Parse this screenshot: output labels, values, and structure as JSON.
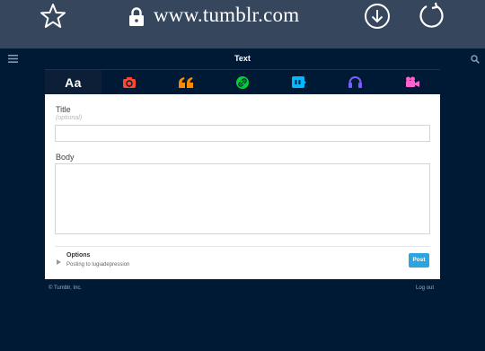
{
  "browser": {
    "url": "www.tumblr.com"
  },
  "header": {
    "title": "Text"
  },
  "tabs": [
    {
      "name": "text",
      "label": "Aa",
      "icon": "text-icon",
      "color": "#ffffff",
      "active": true
    },
    {
      "name": "photo",
      "icon": "camera-icon",
      "color": "#ff492f"
    },
    {
      "name": "quote",
      "icon": "quote-icon",
      "color": "#ff8a00"
    },
    {
      "name": "link",
      "icon": "link-icon",
      "color": "#00cf35"
    },
    {
      "name": "chat",
      "icon": "chat-icon",
      "color": "#00b8ff"
    },
    {
      "name": "audio",
      "icon": "headphones-icon",
      "color": "#7c5cff"
    },
    {
      "name": "video",
      "icon": "video-icon",
      "color": "#ff62ce"
    }
  ],
  "form": {
    "title_label": "Title",
    "title_hint": "(optional)",
    "title_value": "",
    "body_label": "Body",
    "body_value": "",
    "options_label": "Options",
    "options_sub": "Posting to lugiadepression",
    "post_button": "Post"
  },
  "footer": {
    "copyright": "© Tumblr, Inc.",
    "logout": "Log out"
  },
  "colors": {
    "background": "#001935",
    "browser_bar": "#36465d",
    "accent": "#2aa5e0"
  }
}
